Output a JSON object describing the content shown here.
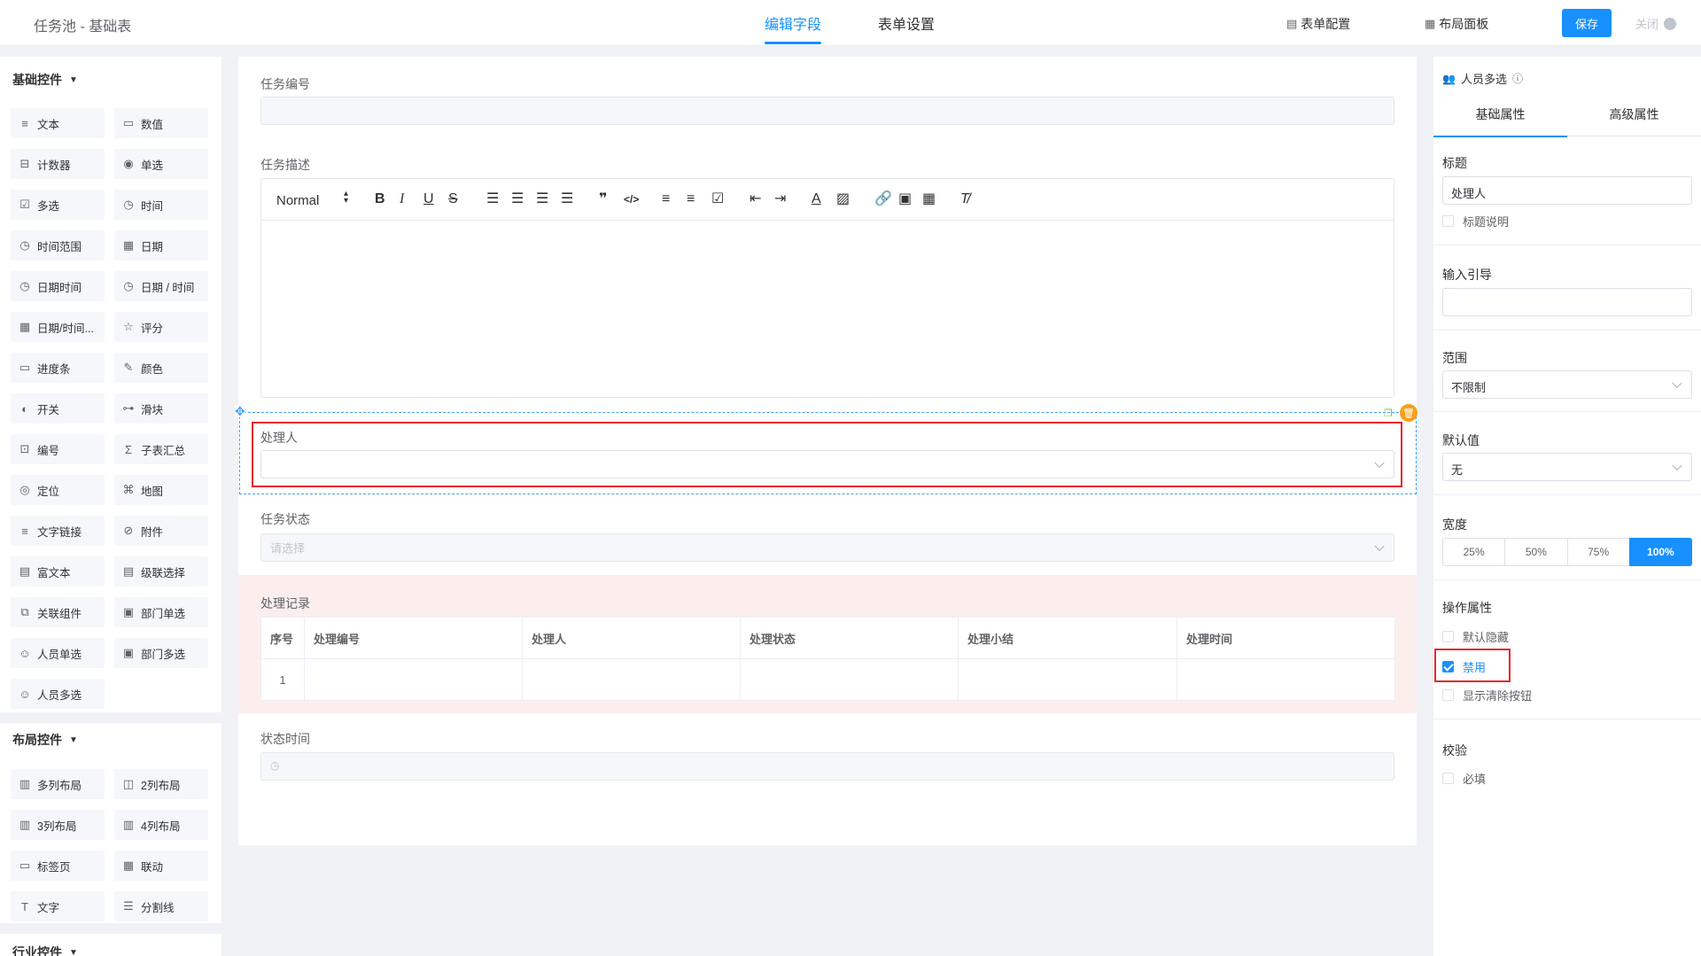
{
  "header": {
    "title": "任务池 - 基础表",
    "tabs": [
      {
        "label": "编辑字段",
        "active": true
      },
      {
        "label": "表单设置",
        "active": false
      }
    ],
    "form_config": "表单配置",
    "layout_panel": "布局面板",
    "save": "保存",
    "close": "关闭"
  },
  "left": {
    "basic_title": "基础控件",
    "basic_items": [
      {
        "label": "文本",
        "icon": "text-icon"
      },
      {
        "label": "数值",
        "icon": "number-icon"
      },
      {
        "label": "计数器",
        "icon": "counter-icon"
      },
      {
        "label": "单选",
        "icon": "radio-icon"
      },
      {
        "label": "多选",
        "icon": "checkbox-icon"
      },
      {
        "label": "时间",
        "icon": "clock-icon"
      },
      {
        "label": "时间范围",
        "icon": "clock-icon"
      },
      {
        "label": "日期",
        "icon": "calendar-icon"
      },
      {
        "label": "日期时间",
        "icon": "clock-icon"
      },
      {
        "label": "日期 / 时间",
        "icon": "clock-icon"
      },
      {
        "label": "日期/时间...",
        "icon": "calendar-icon"
      },
      {
        "label": "评分",
        "icon": "star-icon"
      },
      {
        "label": "进度条",
        "icon": "progress-icon"
      },
      {
        "label": "颜色",
        "icon": "color-picker-icon"
      },
      {
        "label": "开关",
        "icon": "switch-icon"
      },
      {
        "label": "滑块",
        "icon": "slider-icon"
      },
      {
        "label": "编号",
        "icon": "serial-icon"
      },
      {
        "label": "子表汇总",
        "icon": "sigma-icon"
      },
      {
        "label": "定位",
        "icon": "location-icon"
      },
      {
        "label": "地图",
        "icon": "map-icon"
      },
      {
        "label": "文字链接",
        "icon": "link-text-icon"
      },
      {
        "label": "附件",
        "icon": "attachment-icon"
      },
      {
        "label": "富文本",
        "icon": "rich-text-icon"
      },
      {
        "label": "级联选择",
        "icon": "cascade-icon"
      },
      {
        "label": "关联组件",
        "icon": "relation-icon"
      },
      {
        "label": "部门单选",
        "icon": "department-icon"
      },
      {
        "label": "人员单选",
        "icon": "user-icon"
      },
      {
        "label": "部门多选",
        "icon": "department-icon"
      },
      {
        "label": "人员多选",
        "icon": "users-icon"
      }
    ],
    "layout_title": "布局控件",
    "layout_items": [
      {
        "label": "多列布局",
        "icon": "columns-icon"
      },
      {
        "label": "2列布局",
        "icon": "two-columns-icon"
      },
      {
        "label": "3列布局",
        "icon": "three-columns-icon"
      },
      {
        "label": "4列布局",
        "icon": "four-columns-icon"
      },
      {
        "label": "标签页",
        "icon": "tabs-icon"
      },
      {
        "label": "联动",
        "icon": "grid-icon"
      },
      {
        "label": "文字",
        "icon": "text-t-icon"
      },
      {
        "label": "分割线",
        "icon": "divider-icon"
      }
    ],
    "industry_title": "行业控件"
  },
  "canvas": {
    "task_no_label": "任务编号",
    "task_desc_label": "任务描述",
    "editor_font": "Normal",
    "handler_label": "处理人",
    "task_status_label": "任务状态",
    "task_status_placeholder": "请选择",
    "records_label": "处理记录",
    "records_columns": [
      "序号",
      "处理编号",
      "处理人",
      "处理状态",
      "处理小结",
      "处理时间"
    ],
    "records_rows": [
      [
        "1",
        "",
        "",
        "",
        "",
        ""
      ]
    ],
    "status_time_label": "状态时间"
  },
  "right": {
    "header": "人员多选",
    "tabs": [
      "基础属性",
      "高级属性"
    ],
    "title_label": "标题",
    "title_value": "处理人",
    "title_desc": "标题说明",
    "guide_label": "输入引导",
    "range_label": "范围",
    "range_value": "不限制",
    "default_label": "默认值",
    "default_value": "无",
    "width_label": "宽度",
    "width_options": [
      "25%",
      "50%",
      "75%",
      "100%"
    ],
    "width_selected": "100%",
    "ops_label": "操作属性",
    "ops": [
      {
        "label": "默认隐藏",
        "checked": false
      },
      {
        "label": "禁用",
        "checked": true
      },
      {
        "label": "显示清除按钮",
        "checked": false
      }
    ],
    "validate_label": "校验",
    "required_label": "必填"
  },
  "colors": {
    "accent": "#1890ff",
    "highlight_border": "#e5272d",
    "record_bg": "#fdeeee"
  }
}
